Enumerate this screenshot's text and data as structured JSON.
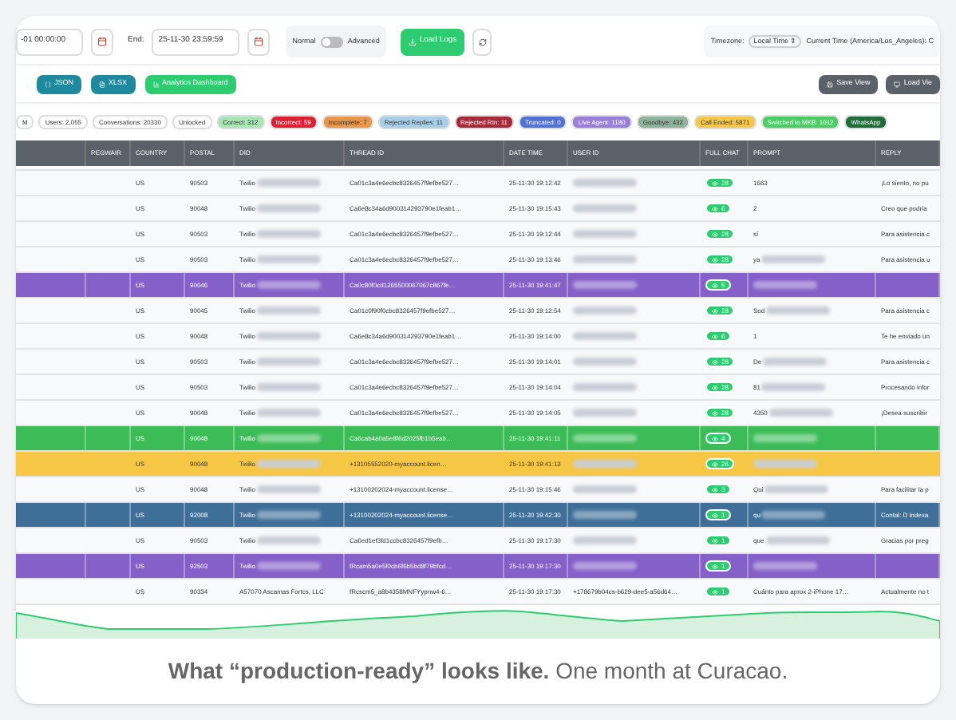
{
  "toolbar": {
    "start_value": "-01 00:00:00",
    "end_label": "End:",
    "end_value": "25-11-30 23:59:59",
    "mode_switch": {
      "left_label": "Normal",
      "right_label": "Advanced",
      "on": false
    },
    "load_button": "Load Logs",
    "timezone_label": "Timezone:",
    "timezone_value": "Local Time ⇕",
    "current_time": "Current Time (America/Los_Angeles): C"
  },
  "actions": [
    {
      "label": "JSON",
      "kind": "export"
    },
    {
      "label": "XLSX",
      "kind": "export"
    },
    {
      "label": "Analytics Dashboard",
      "kind": "primary"
    }
  ],
  "view_buttons": [
    {
      "label": "Save View",
      "kind": "save"
    },
    {
      "label": "Load Vie",
      "kind": "load"
    }
  ],
  "chips": [
    {
      "label": "M",
      "color": "#ffffff"
    },
    {
      "label": "Users: 2,055",
      "color": "#ffffff"
    },
    {
      "label": "Conversations: 20330",
      "color": "#ffffff"
    },
    {
      "label": "Unlocked",
      "color": "#ffffff"
    },
    {
      "label": "Correct: 312",
      "color": "#a8e6b4"
    },
    {
      "label": "Incorrect: 59",
      "color": "#dc2035"
    },
    {
      "label": "Incomplete: 7",
      "color": "#e8964a"
    },
    {
      "label": "Rejected Replies: 11",
      "color": "#a9cfe8"
    },
    {
      "label": "Rejected Rtn: 11",
      "color": "#a52a3a"
    },
    {
      "label": "Truncated: 0",
      "color": "#4f72d4"
    },
    {
      "label": "Live Agent: 1180",
      "color": "#9a7fd8"
    },
    {
      "label": "Goodbye: 432",
      "color": "#8fb39a"
    },
    {
      "label": "Call Ended: 5871",
      "color": "#f5c84c"
    },
    {
      "label": "Switched to MKB: 1012",
      "color": "#4ccb66"
    },
    {
      "label": "WhatsApp",
      "color": "#1f6b3a"
    }
  ],
  "table": {
    "columns": [
      "",
      "REGWAIR",
      "COUNTRY",
      "POSTAL",
      "DID",
      "THREAD ID",
      "DATE TIME",
      "USER ID",
      "FULL CHAT",
      "PROMPT",
      "REPLY"
    ],
    "rows": [
      {
        "color": "#f8f9fa",
        "country": "US",
        "postal": "90503",
        "did": "Twilio",
        "did_redacted": true,
        "thread_id": "Ca01c3a4e6ecbc8326457f9efbe527…",
        "date_time": "25-11-30 19:12:42",
        "chat_count": "28",
        "prompt": "1663",
        "prompt_redacted": false,
        "reply": "¡Lo siento, no pu"
      },
      {
        "color": "#f8f9fa",
        "country": "US",
        "postal": "90048",
        "did": "Twilio",
        "did_redacted": true,
        "thread_id": "Ca6e8c34a6d900314293790e1feab1…",
        "date_time": "25-11-30 19:15:43",
        "chat_count": "6",
        "prompt": "2",
        "prompt_redacted": false,
        "reply": "Creo que podría"
      },
      {
        "color": "#f8f9fa",
        "country": "US",
        "postal": "90503",
        "did": "Twilio",
        "did_redacted": true,
        "thread_id": "Ca01c3a4e6ecbc8326457f9efbe527…",
        "date_time": "25-11-30 19:12:44",
        "chat_count": "28",
        "prompt": "sí",
        "prompt_redacted": false,
        "reply": "Para asistencia c"
      },
      {
        "color": "#f8f9fa",
        "country": "US",
        "postal": "90503",
        "did": "Twilio",
        "did_redacted": true,
        "thread_id": "Ca01c3a4e6ecbc8326457f9efbe527…",
        "date_time": "25-11-30 19:13:46",
        "chat_count": "28",
        "prompt": "ya",
        "prompt_redacted": true,
        "reply": "Para asistencia u"
      },
      {
        "color": "#8560c8",
        "country": "US",
        "postal": "90046",
        "did": "Twilio",
        "did_redacted": true,
        "thread_id": "Ca0c80f0cd1265500067067c867fe…",
        "date_time": "25-11-30 19:41:47",
        "chat_count": "5",
        "prompt": "",
        "prompt_redacted": true,
        "reply": ""
      },
      {
        "color": "#f8f9fa",
        "country": "US",
        "postal": "90045",
        "did": "Twilio",
        "did_redacted": true,
        "thread_id": "Ca01c0f90f0cbc8326457f9efbe527…",
        "date_time": "25-11-30 19:12:54",
        "chat_count": "28",
        "prompt": "Sod",
        "prompt_redacted": true,
        "reply": "Para asistencia c"
      },
      {
        "color": "#f8f9fa",
        "country": "US",
        "postal": "90048",
        "did": "Twilio",
        "did_redacted": true,
        "thread_id": "Ca6e8c34a6d900314293790e1feab1…",
        "date_time": "25-11-30 19:14:00",
        "chat_count": "6",
        "prompt": "1",
        "prompt_redacted": false,
        "reply": "Te he enviado un"
      },
      {
        "color": "#f8f9fa",
        "country": "US",
        "postal": "90503",
        "did": "Twilio",
        "did_redacted": true,
        "thread_id": "Ca01c3a4e6ecbc8326457f9efbe527…",
        "date_time": "25-11-30 19:14:01",
        "chat_count": "28",
        "prompt": "De",
        "prompt_redacted": true,
        "reply": "Para asistencia c"
      },
      {
        "color": "#f8f9fa",
        "country": "US",
        "postal": "90503",
        "did": "Twilio",
        "did_redacted": true,
        "thread_id": "Ca01c3a4e6ecbc8326457f9efbe527…",
        "date_time": "25-11-30 19:14:04",
        "chat_count": "28",
        "prompt": "81",
        "prompt_redacted": true,
        "reply": "Procesando infor"
      },
      {
        "color": "#f8f9fa",
        "country": "US",
        "postal": "90048",
        "did": "Twilio",
        "did_redacted": true,
        "thread_id": "Ca01c3a4e6ecbc8326457f9efbe527…",
        "date_time": "25-11-30 19:14:05",
        "chat_count": "28",
        "prompt": "4350",
        "prompt_redacted": true,
        "reply": "¡Desea suscribir"
      },
      {
        "color": "#3cbc57",
        "country": "US",
        "postal": "90048",
        "did": "Twilio",
        "did_redacted": true,
        "thread_id": "Ca6cab4a0a5e8f6d2025fb1b5eab…",
        "date_time": "25-11-30 19:41:11",
        "chat_count": "4",
        "prompt": "",
        "prompt_redacted": true,
        "reply": ""
      },
      {
        "color": "#f6c744",
        "country": "US",
        "postal": "90048",
        "did": "Twilio",
        "did_redacted": true,
        "thread_id": "+13105552020-myaccount.licen…",
        "date_time": "25-11-30 19:41:13",
        "chat_count": "26",
        "prompt": "",
        "prompt_redacted": true,
        "reply": ""
      },
      {
        "color": "#f8f9fa",
        "country": "US",
        "postal": "90048",
        "did": "Twilio",
        "did_redacted": true,
        "thread_id": "+13100202024-myaccount.license…",
        "date_time": "25-11-30 19:15:46",
        "chat_count": "3",
        "prompt": "Qui",
        "prompt_redacted": true,
        "reply": "Para facilitar la p"
      },
      {
        "color": "#3f6f99",
        "country": "US",
        "postal": "92008",
        "did": "Twilio",
        "did_redacted": true,
        "thread_id": "+13100202024-myaccount.license…",
        "date_time": "25-11-30 19:42:30",
        "chat_count": "1",
        "prompt": "qu",
        "prompt_redacted": true,
        "reply": "Contal: D indexa"
      },
      {
        "color": "#f8f9fa",
        "country": "US",
        "postal": "90503",
        "did": "Twilio",
        "did_redacted": true,
        "thread_id": "Ca6ed1ef3fd1ccbc8326457f9efb…",
        "date_time": "25-11-30 19:17:30",
        "chat_count": "1",
        "prompt": "que",
        "prompt_redacted": true,
        "reply": "Gracias por preg"
      },
      {
        "color": "#8560c8",
        "country": "US",
        "postal": "92503",
        "did": "Twilio",
        "did_redacted": true,
        "thread_id": "fRcam5a0e5f0cb6f6b5bd8f79bfcd…",
        "date_time": "25-11-30 19:17:30",
        "chat_count": "1",
        "prompt": "",
        "prompt_redacted": true,
        "reply": ""
      },
      {
        "color": "#f8f9fa",
        "country": "US",
        "postal": "90334",
        "did": "A57070 Ascamas Fortcs, LLC",
        "did_redacted": false,
        "thread_id": "fRcscm5_a8b4358MNFYypnw4-6…",
        "date_time": "25-11-30 19:17:30",
        "user_id": "+178679b04cs-b629-dee5-a56d64…",
        "chat_count": "1",
        "prompt": "Cuánto para aprox 2-iPhone 17…",
        "prompt_redacted": false,
        "reply": "Actualmente no t"
      }
    ]
  },
  "caption": "**What “production-ready” looks like.** One month at Curacao."
}
